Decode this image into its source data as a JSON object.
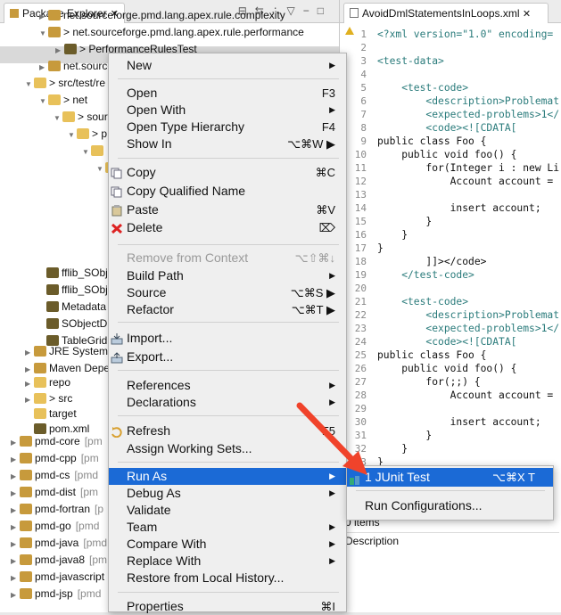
{
  "explorer": {
    "tab_title": "Package Explorer",
    "tab_close": "✕",
    "tree": [
      {
        "label": "net.sourceforge.pmd.lang.apex.rule.complexity",
        "kind": "pkg",
        "twisty": "▶"
      },
      {
        "label": "> net.sourceforge.pmd.lang.apex.rule.performance",
        "kind": "pkg",
        "twisty": "▼"
      },
      {
        "label": "> PerformanceRulesTest",
        "kind": "jf",
        "twisty": "▶"
      },
      {
        "label": "net.sourcefor",
        "kind": "pkg",
        "twisty": "▶"
      },
      {
        "label": "> src/test/re",
        "kind": "fld",
        "twisty": "▼"
      },
      {
        "label": "> net",
        "kind": "fld",
        "twisty": "▼"
      },
      {
        "label": "> sour",
        "kind": "fld",
        "twisty": "▼"
      },
      {
        "label": "> p",
        "kind": "fld",
        "twisty": "▼"
      },
      {
        "label": "",
        "kind": "fld",
        "twisty": "▼"
      },
      {
        "label": "",
        "kind": "fld",
        "twisty": "▼"
      }
    ],
    "tree_lower": [
      {
        "label": "fflib_SObj",
        "kind": "jf"
      },
      {
        "label": "fflib_SObj",
        "kind": "jf"
      },
      {
        "label": "Metadata",
        "kind": "jf"
      },
      {
        "label": "SObjectD",
        "kind": "jf"
      },
      {
        "label": "TableGrid",
        "kind": "jf"
      },
      {
        "label": "JRE System",
        "kind": "pkg",
        "twisty": "▶"
      },
      {
        "label": "Maven Depe",
        "kind": "pkg",
        "twisty": "▶"
      },
      {
        "label": "repo",
        "kind": "fld",
        "twisty": "▶"
      },
      {
        "label": "> src",
        "kind": "fld",
        "twisty": "▶"
      },
      {
        "label": "target",
        "kind": "fld",
        "twisty": ""
      },
      {
        "label": "pom.xml",
        "kind": "jf",
        "twisty": ""
      }
    ],
    "projects": [
      {
        "label": "pmd-core",
        "suffix": "[pm"
      },
      {
        "label": "pmd-cpp",
        "suffix": "[pm"
      },
      {
        "label": "pmd-cs",
        "suffix": "[pmd"
      },
      {
        "label": "pmd-dist",
        "suffix": "[pm"
      },
      {
        "label": "pmd-fortran",
        "suffix": "[p"
      },
      {
        "label": "pmd-go",
        "suffix": "[pmd"
      },
      {
        "label": "pmd-java",
        "suffix": "[pmd"
      },
      {
        "label": "pmd-java8",
        "suffix": "[pm"
      },
      {
        "label": "pmd-javascript",
        "suffix": ""
      },
      {
        "label": "pmd-jsp",
        "suffix": "[pmd"
      }
    ]
  },
  "editor": {
    "tab_title": "AvoidDmlStatementsInLoops.xml",
    "tab_close": "✕",
    "lines": [
      "<?xml version=\"1.0\" encoding=",
      "",
      "<test-data>",
      "",
      "    <test-code>",
      "        <description>Problemat",
      "        <expected-problems>1</",
      "        <code><![CDATA[",
      "public class Foo {",
      "    public void foo() {",
      "        for(Integer i : new Li",
      "            Account account =",
      "",
      "            insert account;",
      "        }",
      "    }",
      "}",
      "        ]]></code>",
      "    </test-code>",
      "",
      "    <test-code>",
      "        <description>Problemat",
      "        <expected-problems>1</",
      "        <code><![CDATA[",
      "public class Foo {",
      "    public void foo() {",
      "        for(;;) {",
      "            Account account =",
      "",
      "            insert account;",
      "        }",
      "    }",
      "}"
    ],
    "line_numbers": [
      "1",
      "2",
      "3",
      "4",
      "5",
      "6",
      "7",
      "8",
      "9",
      "10",
      "11",
      "12",
      "13",
      "14",
      "15",
      "16",
      "17",
      "18",
      "19",
      "20",
      "21",
      "22",
      "23",
      "24",
      "25",
      "26",
      "27",
      "28",
      "29",
      "30",
      "31",
      "32",
      "33"
    ],
    "bottom_items": "0 items",
    "bottom_header": "Description"
  },
  "context_menu": {
    "items": [
      {
        "label": "New",
        "arrow": "▶"
      },
      {
        "label": "Open",
        "shortcut": "F3"
      },
      {
        "label": "Open With",
        "arrow": "▶"
      },
      {
        "label": "Open Type Hierarchy",
        "shortcut": "F4"
      },
      {
        "label": "Show In",
        "shortcut": "⌥⌘W ▶"
      },
      {
        "label": "Copy",
        "shortcut": "⌘C",
        "icon": "copy-icon"
      },
      {
        "label": "Copy Qualified Name",
        "icon": "copy-icon"
      },
      {
        "label": "Paste",
        "shortcut": "⌘V",
        "icon": "paste-icon"
      },
      {
        "label": "Delete",
        "shortcut": "⌦",
        "icon": "delete-icon"
      },
      {
        "label": "Remove from Context",
        "shortcut": "⌥⇧⌘↓",
        "disabled": true
      },
      {
        "label": "Build Path",
        "arrow": "▶"
      },
      {
        "label": "Source",
        "shortcut": "⌥⌘S ▶"
      },
      {
        "label": "Refactor",
        "shortcut": "⌥⌘T ▶"
      },
      {
        "label": "Import...",
        "icon": "import-icon"
      },
      {
        "label": "Export...",
        "icon": "export-icon"
      },
      {
        "label": "References",
        "arrow": "▶"
      },
      {
        "label": "Declarations",
        "arrow": "▶"
      },
      {
        "label": "Refresh",
        "shortcut": "F5",
        "icon": "refresh-icon"
      },
      {
        "label": "Assign Working Sets..."
      },
      {
        "label": "Run As",
        "arrow": "▶",
        "highlighted": true
      },
      {
        "label": "Debug As",
        "arrow": "▶"
      },
      {
        "label": "Validate"
      },
      {
        "label": "Team",
        "arrow": "▶"
      },
      {
        "label": "Compare With",
        "arrow": "▶"
      },
      {
        "label": "Replace With",
        "arrow": "▶"
      },
      {
        "label": "Restore from Local History..."
      },
      {
        "label": "Properties",
        "shortcut": "⌘I"
      }
    ]
  },
  "run_as_submenu": {
    "items": [
      {
        "label": "1 JUnit Test",
        "shortcut": "⌥⌘X T",
        "highlighted": true
      },
      {
        "label": "Run Configurations..."
      }
    ]
  },
  "colors": {
    "highlight": "#1b6ad6",
    "arrow": "#f0432b"
  }
}
